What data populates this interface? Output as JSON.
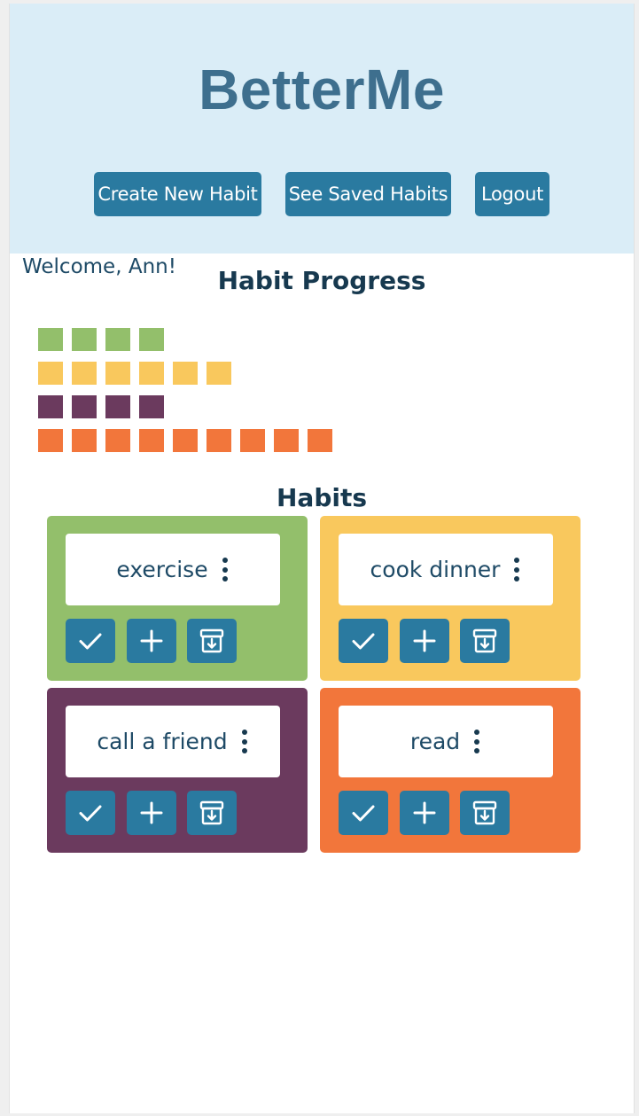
{
  "app": {
    "title": "BetterMe"
  },
  "nav": {
    "create_label": "Create New Habit",
    "saved_label": "See Saved Habits",
    "logout_label": "Logout"
  },
  "welcome": "Welcome, Ann!",
  "progress": {
    "title": "Habit Progress",
    "rows": [
      {
        "habit": "exercise",
        "count": 4,
        "color": "#93bf6b"
      },
      {
        "habit": "cook dinner",
        "count": 6,
        "color": "#f9c85d"
      },
      {
        "habit": "call a friend",
        "count": 4,
        "color": "#6b3a5e"
      },
      {
        "habit": "read",
        "count": 9,
        "color": "#f2763b"
      }
    ]
  },
  "habits": {
    "title": "Habits",
    "items": [
      {
        "name": "exercise",
        "color": "#93bf6b"
      },
      {
        "name": "cook dinner",
        "color": "#f9c85d"
      },
      {
        "name": "call a friend",
        "color": "#6b3a5e"
      },
      {
        "name": "read",
        "color": "#f2763b"
      }
    ],
    "actions": [
      "check-icon",
      "plus-icon",
      "archive-icon"
    ]
  },
  "colors": {
    "header_bg": "#daedf7",
    "title": "#3e6f8e",
    "button": "#2a7aa0",
    "text_dark": "#17394f"
  }
}
